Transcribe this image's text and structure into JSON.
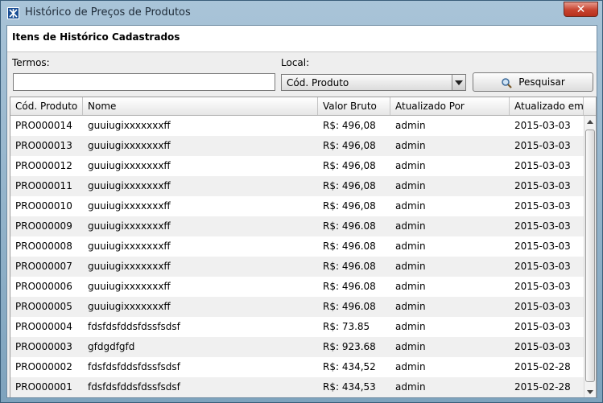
{
  "window": {
    "title": "Histórico de Preços de Produtos",
    "close_label": "✕"
  },
  "header": {
    "title": "Itens de Histórico Cadastrados"
  },
  "search": {
    "termos_label": "Termos:",
    "termos_value": "",
    "local_label": "Local:",
    "local_selected": "Cód. Produto",
    "button_label": "Pesquisar"
  },
  "table": {
    "columns": [
      "Cód. Produto",
      "Nome",
      "Valor Bruto",
      "Atualizado Por",
      "Atualizado em"
    ],
    "rows": [
      [
        "PRO000014",
        "guuiugixxxxxxxff",
        "R$: 496,08",
        "admin",
        "2015-03-03"
      ],
      [
        "PRO000013",
        "guuiugixxxxxxxff",
        "R$: 496,08",
        "admin",
        "2015-03-03"
      ],
      [
        "PRO000012",
        "guuiugixxxxxxxff",
        "R$: 496,08",
        "admin",
        "2015-03-03"
      ],
      [
        "PRO000011",
        "guuiugixxxxxxxff",
        "R$: 496,08",
        "admin",
        "2015-03-03"
      ],
      [
        "PRO000010",
        "guuiugixxxxxxxff",
        "R$: 496,08",
        "admin",
        "2015-03-03"
      ],
      [
        "PRO000009",
        "guuiugixxxxxxxff",
        "R$: 496.08",
        "admin",
        "2015-03-03"
      ],
      [
        "PRO000008",
        "guuiugixxxxxxxff",
        "R$: 496.08",
        "admin",
        "2015-03-03"
      ],
      [
        "PRO000007",
        "guuiugixxxxxxxff",
        "R$: 496.08",
        "admin",
        "2015-03-03"
      ],
      [
        "PRO000006",
        "guuiugixxxxxxxff",
        "R$: 496.08",
        "admin",
        "2015-03-03"
      ],
      [
        "PRO000005",
        "guuiugixxxxxxxff",
        "R$: 496.08",
        "admin",
        "2015-03-03"
      ],
      [
        "PRO000004",
        "fdsfdsfddsfdssfsdsf",
        "R$: 73.85",
        "admin",
        "2015-03-03"
      ],
      [
        "PRO000003",
        "gfdgdfgfd",
        "R$: 923.68",
        "admin",
        "2015-03-03"
      ],
      [
        "PRO000002",
        "fdsfdsfddsfdssfsdsf",
        "R$: 434,52",
        "admin",
        "2015-02-28"
      ],
      [
        "PRO000001",
        "fdsfdsfddsfdssfsdsf",
        "R$: 434,53",
        "admin",
        "2015-02-28"
      ]
    ]
  },
  "colors": {
    "accent_title": "#1b4f95",
    "close_red": "#c7432f",
    "row_alt": "#f0f0f0"
  },
  "icons": {
    "app": "app-logo-icon",
    "search": "magnifier-icon",
    "close": "close-icon"
  }
}
